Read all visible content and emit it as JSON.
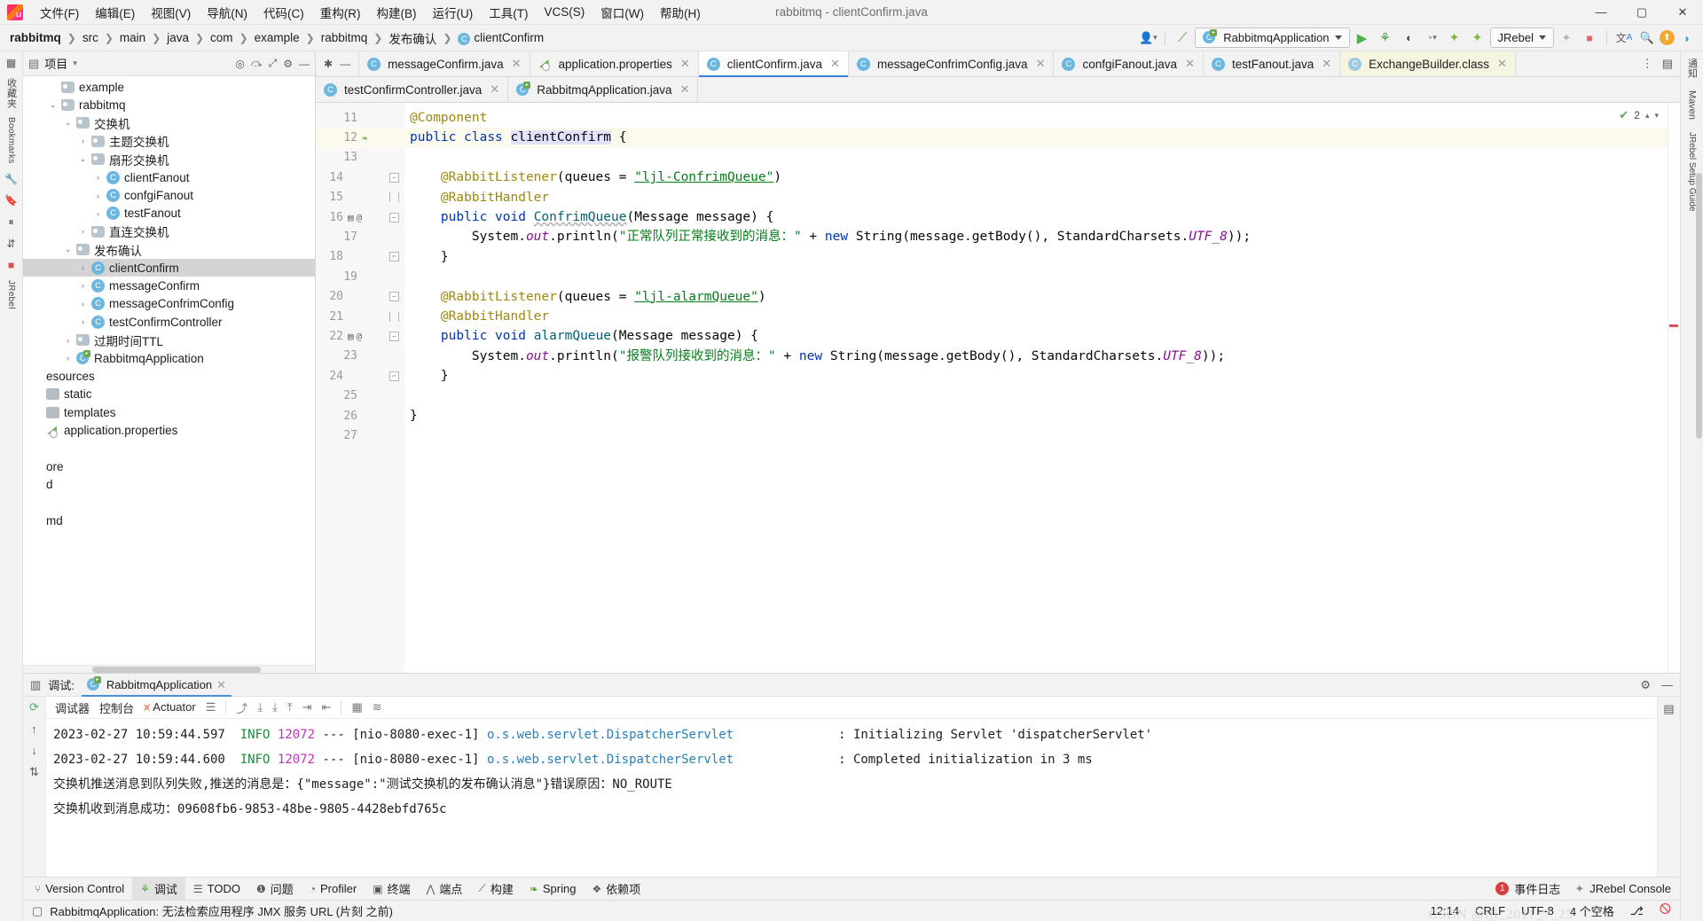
{
  "window": {
    "title": "rabbitmq - clientConfirm.java",
    "minimize": "—",
    "maximize": "▢",
    "close": "✕"
  },
  "menu": {
    "items": [
      {
        "label": "文件(F)"
      },
      {
        "label": "编辑(E)"
      },
      {
        "label": "视图(V)"
      },
      {
        "label": "导航(N)"
      },
      {
        "label": "代码(C)"
      },
      {
        "label": "重构(R)"
      },
      {
        "label": "构建(B)"
      },
      {
        "label": "运行(U)"
      },
      {
        "label": "工具(T)"
      },
      {
        "label": "VCS(S)"
      },
      {
        "label": "窗口(W)"
      },
      {
        "label": "帮助(H)"
      }
    ]
  },
  "breadcrumb": {
    "items": [
      "rabbitmq",
      "src",
      "main",
      "java",
      "com",
      "example",
      "rabbitmq",
      "发布确认"
    ],
    "file": "clientConfirm",
    "file_badge": "C",
    "separator": "❯"
  },
  "toolbar": {
    "run_config": "RabbitmqApplication",
    "jrebel": "JRebel",
    "icons": [
      {
        "name": "profile-icon",
        "glyph": "👤"
      },
      {
        "name": "build-hammer-icon",
        "glyph": "⌁"
      },
      {
        "name": "run-icon",
        "glyph": "▶"
      },
      {
        "name": "debug-icon",
        "glyph": "🐞"
      },
      {
        "name": "run-with-coverage-icon",
        "glyph": "◑"
      },
      {
        "name": "clock-icon",
        "glyph": "◔"
      },
      {
        "name": "jrebel-run-icon",
        "glyph": "✈"
      },
      {
        "name": "jrebel-debug-icon",
        "glyph": "✈"
      },
      {
        "name": "stop-icon",
        "glyph": "■"
      },
      {
        "name": "translate-icon",
        "glyph": "文"
      },
      {
        "name": "search-everywhere-icon",
        "glyph": "🔍"
      },
      {
        "name": "update-icon",
        "glyph": "⬆"
      },
      {
        "name": "ide-feature-icon",
        "glyph": "◗"
      }
    ]
  },
  "project_panel": {
    "title": "项目",
    "header_icons": [
      "target-icon",
      "collapse-icon",
      "expand-icon",
      "gear-icon",
      "hide-icon"
    ],
    "tree": [
      {
        "indent": 1,
        "arrow": "",
        "icon": "folder",
        "label": "example"
      },
      {
        "indent": 1,
        "arrow": "⌄",
        "icon": "folder",
        "label": "rabbitmq"
      },
      {
        "indent": 2,
        "arrow": "⌄",
        "icon": "folder",
        "label": "交换机"
      },
      {
        "indent": 3,
        "arrow": "›",
        "icon": "folder",
        "label": "主题交换机"
      },
      {
        "indent": 3,
        "arrow": "⌄",
        "icon": "folder",
        "label": "扇形交换机"
      },
      {
        "indent": 4,
        "arrow": "›",
        "icon": "class",
        "label": "clientFanout"
      },
      {
        "indent": 4,
        "arrow": "›",
        "icon": "class",
        "label": "confgiFanout"
      },
      {
        "indent": 4,
        "arrow": "›",
        "icon": "class",
        "label": "testFanout"
      },
      {
        "indent": 3,
        "arrow": "›",
        "icon": "folder",
        "label": "直连交换机"
      },
      {
        "indent": 2,
        "arrow": "⌄",
        "icon": "folder",
        "label": "发布确认"
      },
      {
        "indent": 3,
        "arrow": "›",
        "icon": "class",
        "label": "clientConfirm",
        "selected": true
      },
      {
        "indent": 3,
        "arrow": "›",
        "icon": "class",
        "label": "messageConfirm"
      },
      {
        "indent": 3,
        "arrow": "›",
        "icon": "class",
        "label": "messageConfrimConfig"
      },
      {
        "indent": 3,
        "arrow": "›",
        "icon": "class",
        "label": "testConfirmController"
      },
      {
        "indent": 2,
        "arrow": "›",
        "icon": "folder",
        "label": "过期时间TTL"
      },
      {
        "indent": 2,
        "arrow": "›",
        "icon": "spring",
        "label": "RabbitmqApplication"
      },
      {
        "indent": 0,
        "arrow": "",
        "icon": "none",
        "label": "esources"
      },
      {
        "indent": 0,
        "arrow": "",
        "icon": "plain",
        "label": "static"
      },
      {
        "indent": 0,
        "arrow": "",
        "icon": "plain",
        "label": "templates"
      },
      {
        "indent": 0,
        "arrow": "",
        "icon": "prop",
        "label": "application.properties"
      },
      {
        "indent": 0,
        "arrow": "",
        "icon": "none",
        "label": ""
      },
      {
        "indent": 0,
        "arrow": "",
        "icon": "none",
        "label": "ore"
      },
      {
        "indent": 0,
        "arrow": "",
        "icon": "none",
        "label": "d"
      },
      {
        "indent": 0,
        "arrow": "",
        "icon": "none",
        "label": ""
      },
      {
        "indent": 0,
        "arrow": "",
        "icon": "none",
        "label": "md"
      }
    ]
  },
  "editor": {
    "tabs_row1": [
      {
        "label": "messageConfirm.java",
        "icon": "class",
        "state": "normal"
      },
      {
        "label": "application.properties",
        "icon": "prop",
        "state": "normal"
      },
      {
        "label": "clientConfirm.java",
        "icon": "class",
        "state": "active"
      },
      {
        "label": "messageConfrimConfig.java",
        "icon": "class",
        "state": "normal"
      },
      {
        "label": "confgiFanout.java",
        "icon": "class",
        "state": "normal"
      },
      {
        "label": "testFanout.java",
        "icon": "class",
        "state": "normal"
      },
      {
        "label": "ExchangeBuilder.class",
        "icon": "class-lib",
        "state": "library"
      }
    ],
    "tabs_row2": [
      {
        "label": "testConfirmController.java",
        "icon": "class",
        "state": "normal"
      },
      {
        "label": "RabbitmqApplication.java",
        "icon": "spring",
        "state": "normal"
      }
    ],
    "tab_close_glyph": "✕",
    "inspection_count": "2",
    "lines": [
      {
        "n": "11",
        "marks": "",
        "fold": "",
        "html": "<span class='ann'>@Component</span>"
      },
      {
        "n": "12",
        "marks": "spring",
        "fold": "",
        "hl": true,
        "html": "<span class='kw'>public</span> <span class='kw'>class</span> <span class='idsel'>clientConfirm</span> {"
      },
      {
        "n": "13",
        "marks": "",
        "fold": "",
        "html": ""
      },
      {
        "n": "14",
        "marks": "",
        "fold": "start",
        "html": "    <span class='ann'>@RabbitListener</span>(queues = <span class='str-u'>\"ljl-ConfrimQueue\"</span>)"
      },
      {
        "n": "15",
        "marks": "",
        "fold": "mid",
        "html": "    <span class='ann'>@RabbitHandler</span>"
      },
      {
        "n": "16",
        "marks": "bean-at",
        "fold": "start",
        "html": "    <span class='kw'>public</span> <span class='kw'>void</span> <span class='mth wavy'>ConfrimQueue</span>(Message message) {"
      },
      {
        "n": "17",
        "marks": "",
        "fold": "",
        "html": "        System.<span class='fld'>out</span>.println(<span class='str'>\"正常队列正常接收到的消息：\"</span> + <span class='kw'>new</span> String(message.getBody(), StandardCharsets.<span class='fld'>UTF_8</span>));"
      },
      {
        "n": "18",
        "marks": "",
        "fold": "end",
        "html": "    }"
      },
      {
        "n": "19",
        "marks": "",
        "fold": "",
        "html": ""
      },
      {
        "n": "20",
        "marks": "",
        "fold": "start",
        "html": "    <span class='ann'>@RabbitListener</span>(queues = <span class='str-u'>\"ljl-alarmQueue\"</span>)"
      },
      {
        "n": "21",
        "marks": "",
        "fold": "mid",
        "html": "    <span class='ann'>@RabbitHandler</span>"
      },
      {
        "n": "22",
        "marks": "bean-at",
        "fold": "start",
        "html": "    <span class='kw'>public</span> <span class='kw'>void</span> <span class='mth'>alarmQueue</span>(Message message) {"
      },
      {
        "n": "23",
        "marks": "",
        "fold": "",
        "html": "        System.<span class='fld'>out</span>.println(<span class='str'>\"报警队列接收到的消息：\"</span> + <span class='kw'>new</span> String(message.getBody(), StandardCharsets.<span class='fld'>UTF_8</span>));"
      },
      {
        "n": "24",
        "marks": "",
        "fold": "end",
        "html": "    }"
      },
      {
        "n": "25",
        "marks": "",
        "fold": "",
        "html": ""
      },
      {
        "n": "26",
        "marks": "",
        "fold": "",
        "html": "}"
      },
      {
        "n": "27",
        "marks": "",
        "fold": "",
        "html": ""
      }
    ]
  },
  "debug_panel": {
    "label": "调试:",
    "session_tab": "RabbitmqApplication",
    "close_glyph": "✕",
    "tabs": [
      "调试器",
      "控制台"
    ],
    "actuator": "Actuator",
    "console_lines": [
      {
        "type": "log",
        "ts": "2023-02-27 10:59:44.597",
        "level": "INFO",
        "pid": "12072",
        "dash": "---",
        "thread": "[nio-8080-exec-1]",
        "logger": "o.s.web.servlet.DispatcherServlet",
        "colon": ":",
        "msg": "Initializing Servlet 'dispatcherServlet'"
      },
      {
        "type": "log",
        "ts": "2023-02-27 10:59:44.600",
        "level": "INFO",
        "pid": "12072",
        "dash": "---",
        "thread": "[nio-8080-exec-1]",
        "logger": "o.s.web.servlet.DispatcherServlet",
        "colon": ":",
        "msg": "Completed initialization in 3 ms"
      },
      {
        "type": "plain",
        "text": "交换机推送消息到队列失败,推送的消息是：{\"message\":\"测试交换机的发布确认消息\"}错误原因：NO_ROUTE"
      },
      {
        "type": "plain",
        "text": "交换机收到消息成功：09608fb6-9853-48be-9805-4428ebfd765c"
      }
    ]
  },
  "tool_windows": {
    "items": [
      {
        "label": "Version Control",
        "icon": "branch-icon",
        "active": false
      },
      {
        "label": "调试",
        "icon": "debug-icon",
        "active": true
      },
      {
        "label": "TODO",
        "icon": "todo-icon",
        "active": false
      },
      {
        "label": "问题",
        "icon": "problems-icon",
        "active": false
      },
      {
        "label": "Profiler",
        "icon": "profiler-icon",
        "active": false
      },
      {
        "label": "终端",
        "icon": "terminal-icon",
        "active": false
      },
      {
        "label": "端点",
        "icon": "endpoints-icon",
        "active": false
      },
      {
        "label": "构建",
        "icon": "build-icon",
        "active": false
      },
      {
        "label": "Spring",
        "icon": "spring-icon",
        "active": false
      },
      {
        "label": "依赖项",
        "icon": "dependencies-icon",
        "active": false
      }
    ],
    "event_log": "事件日志",
    "event_badge": "1",
    "jrebel_console": "JRebel Console"
  },
  "status_bar": {
    "message": "RabbitmqApplication: 无法检索应用程序 JMX 服务 URL (片刻 之前)",
    "position": "12:14",
    "line_sep": "CRLF",
    "encoding": "UTF-8",
    "indent": "4 个空格",
    "watermark": "CSDN @ljl_2011_7_25"
  },
  "left_strip": {
    "items": [
      "项目",
      "收藏夹",
      "Bookmarks",
      "JRebel"
    ]
  },
  "right_strip": {
    "items": [
      "通知",
      "Maven",
      "JRebel Setup Guide"
    ]
  },
  "colors": {
    "accent": "#3b7dd8",
    "keyword": "#0033b3",
    "string": "#067d17",
    "annotation": "#9e880d",
    "field": "#871094",
    "selection": "#d4d4d4",
    "tab_active": "#ffffff",
    "library_tab": "#f5f4df"
  }
}
